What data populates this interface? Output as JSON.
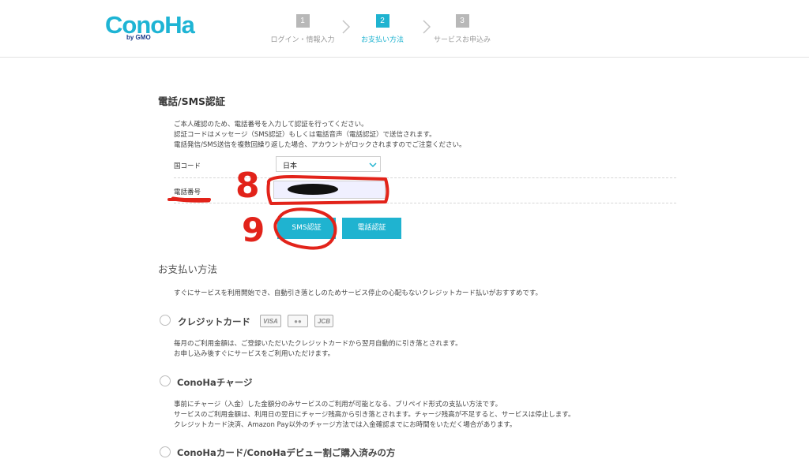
{
  "header": {
    "logo_text": "ConoHa",
    "logo_sub": "by GMO",
    "steps": [
      {
        "num": "1",
        "label": "ログイン・情報入力"
      },
      {
        "num": "2",
        "label": "お支払い方法"
      },
      {
        "num": "3",
        "label": "サービスお申込み"
      }
    ]
  },
  "sms": {
    "title": "電話/SMS認証",
    "desc": [
      "ご本人確認のため、電話番号を入力して認証を行ってください。",
      "認証コードはメッセージ（SMS認証）もしくは電話音声（電話認証）で送信されます。",
      "電話発信/SMS送信を複数回繰り返した場合、アカウントがロックされますのでご注意ください。"
    ],
    "country_label": "国コード",
    "country_value": "日本",
    "phone_label": "電話番号",
    "sms_button": "SMS認証",
    "call_button": "電話認証"
  },
  "payment": {
    "title": "お支払い方法",
    "intro": "すぐにサービスを利用開始でき、自動引き落としのためサービス停止の心配もないクレジットカード払いがおすすめです。",
    "options": [
      {
        "label": "クレジットカード",
        "desc": [
          "毎月のご利用金額は、ご登録いただいたクレジットカードから翌月自動的に引き落とされます。",
          "お申し込み後すぐにサービスをご利用いただけます。"
        ]
      },
      {
        "label": "ConoHaチャージ",
        "desc": [
          "事前にチャージ（入金）した金額分のみサービスのご利用が可能となる、プリペイド形式の支払い方法です。",
          "サービスのご利用金額は、利用日の翌日にチャージ残高から引き落とされます。チャージ残高が不足すると、サービスは停止します。",
          "クレジットカード決済、Amazon Pay以外のチャージ方法では入金確認までにお時間をいただく場合があります。"
        ]
      },
      {
        "label": "ConoHaカード/ConoHaデビュー割ご購入済みの方",
        "desc": []
      }
    ],
    "card_brands": [
      "VISA",
      "●●",
      "JCB"
    ]
  },
  "annotations": {
    "mark_8": "8",
    "mark_9": "9",
    "ink_color": "#e2231a"
  },
  "colors": {
    "accent": "#1fb3d0",
    "step_inactive": "#b8b8b8"
  }
}
